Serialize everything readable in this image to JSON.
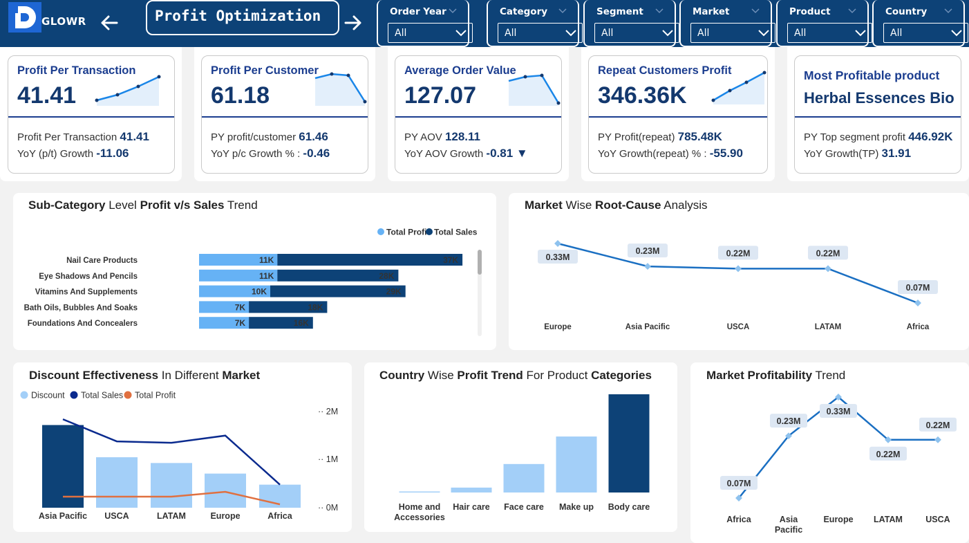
{
  "header": {
    "brand": "GLOWR",
    "title": "Profit Optimization",
    "filters": [
      {
        "label": "Order Year",
        "value": "All"
      },
      {
        "label": "Category",
        "value": "All"
      },
      {
        "label": "Segment",
        "value": "All"
      },
      {
        "label": "Market",
        "value": "All"
      },
      {
        "label": "Product",
        "value": "All"
      },
      {
        "label": "Country",
        "value": "All"
      }
    ]
  },
  "kpis": [
    {
      "title": "Profit Per Transaction",
      "value": "41.41",
      "row1_label": "Profit Per Transaction ",
      "row1_value": "41.41",
      "row2_label": "YoY (p/t) Growth ",
      "row2_value": "-11.06"
    },
    {
      "title": "Profit Per Customer",
      "value": "61.18",
      "row1_label": "PY profit/customer ",
      "row1_value": "61.46",
      "row2_label": "YoY p/c Growth % : ",
      "row2_value": "-0.46"
    },
    {
      "title": "Average Order Value",
      "value": "127.07",
      "row1_label": "PY AOV ",
      "row1_value": "128.11",
      "row2_label": "YoY AOV Growth ",
      "row2_value": "-0.81 ▼"
    },
    {
      "title": "Repeat Customers Profit",
      "value": "346.36K",
      "row1_label": "PY Profit(repeat) ",
      "row1_value": "785.48K",
      "row2_label": "YoY Growth(repeat) % : ",
      "row2_value": "-55.90"
    },
    {
      "title": "Most Profitable product",
      "value": "Herbal Essences Bio",
      "row1_label": "PY Top segment profit ",
      "row1_value": "446.92K",
      "row2_label": "YoY Growth(TP) ",
      "row2_value": "31.91"
    }
  ],
  "colors": {
    "header": "#0d4277",
    "light_bar": "#66b2f5",
    "dark_bar": "#0d4277",
    "line": "#1a6fc2",
    "orange": "#e07040"
  },
  "panels": {
    "subcat": {
      "title_parts": [
        "Sub-Category",
        " Level ",
        "Profit v/s Sales",
        " Trend"
      ]
    },
    "market_root": {
      "title_parts": [
        "Market",
        " Wise ",
        "Root-Cause",
        " Analysis"
      ]
    },
    "discount": {
      "title_parts": [
        "Discount Effectiveness",
        " In Different ",
        "Market"
      ]
    },
    "country": {
      "title_parts": [
        "Country",
        " Wise ",
        "Profit Trend",
        " For Product ",
        "Categories"
      ]
    },
    "market_trend": {
      "title_parts": [
        "Market Profitability",
        " Trend"
      ]
    }
  },
  "chart_data": [
    {
      "type": "bar",
      "name": "subcategory_profit_vs_sales",
      "categories": [
        "Nail Care Products",
        "Eye Shadows And Pencils",
        "Vitamins And Supplements",
        "Bath Oils, Bubbles And Soaks",
        "Foundations And Concealers"
      ],
      "series": [
        {
          "name": "Total Profit",
          "values": [
            11,
            11,
            10,
            7,
            7
          ],
          "labels": [
            "11K",
            "11K",
            "10K",
            "7K",
            "7K"
          ]
        },
        {
          "name": "Total Sales",
          "values": [
            37,
            28,
            29,
            18,
            16
          ],
          "labels": [
            "37K",
            "28K",
            "29K",
            "18K",
            "16K"
          ]
        }
      ],
      "legend": [
        "Total Profit",
        "Total Sales"
      ],
      "legend_position": "top-right",
      "stacked": true
    },
    {
      "type": "line",
      "name": "market_root_cause",
      "categories": [
        "Europe",
        "Asia Pacific",
        "USCA",
        "LATAM",
        "Africa"
      ],
      "values": [
        0.33,
        0.23,
        0.22,
        0.22,
        0.07
      ],
      "labels": [
        "0.33M",
        "0.23M",
        "0.22M",
        "0.22M",
        "0.07M"
      ]
    },
    {
      "type": "bar",
      "name": "discount_effectiveness",
      "categories": [
        "Asia Pacific",
        "USCA",
        "LATAM",
        "Europe",
        "Africa"
      ],
      "series": [
        {
          "name": "Discount",
          "values": [
            1.72,
            1.05,
            0.93,
            0.71,
            0.48
          ]
        },
        {
          "name": "Total Sales",
          "values": [
            1.84,
            1.38,
            1.35,
            1.5,
            0.48
          ]
        },
        {
          "name": "Total Profit",
          "values": [
            0.23,
            0.23,
            0.23,
            0.33,
            0.07
          ]
        }
      ],
      "y_ticks": [
        "2M",
        "1M",
        "0M"
      ],
      "ylim": [
        0,
        2
      ],
      "legend": [
        "Discount",
        "Total Sales",
        "Total Profit"
      ],
      "legend_position": "top-left"
    },
    {
      "type": "bar",
      "name": "country_profit_by_category",
      "categories": [
        "Home and Accessories",
        "Hair care",
        "Face care",
        "Make up",
        "Body care"
      ],
      "values": [
        0.01,
        0.05,
        0.29,
        0.57,
        1.0
      ]
    },
    {
      "type": "line",
      "name": "market_profitability_trend",
      "categories": [
        "Africa",
        "Asia Pacific",
        "Europe",
        "LATAM",
        "USCA"
      ],
      "values": [
        0.07,
        0.23,
        0.33,
        0.22,
        0.22
      ],
      "labels": [
        "0.07M",
        "0.23M",
        "0.33M",
        "0.22M",
        "0.22M"
      ]
    }
  ]
}
